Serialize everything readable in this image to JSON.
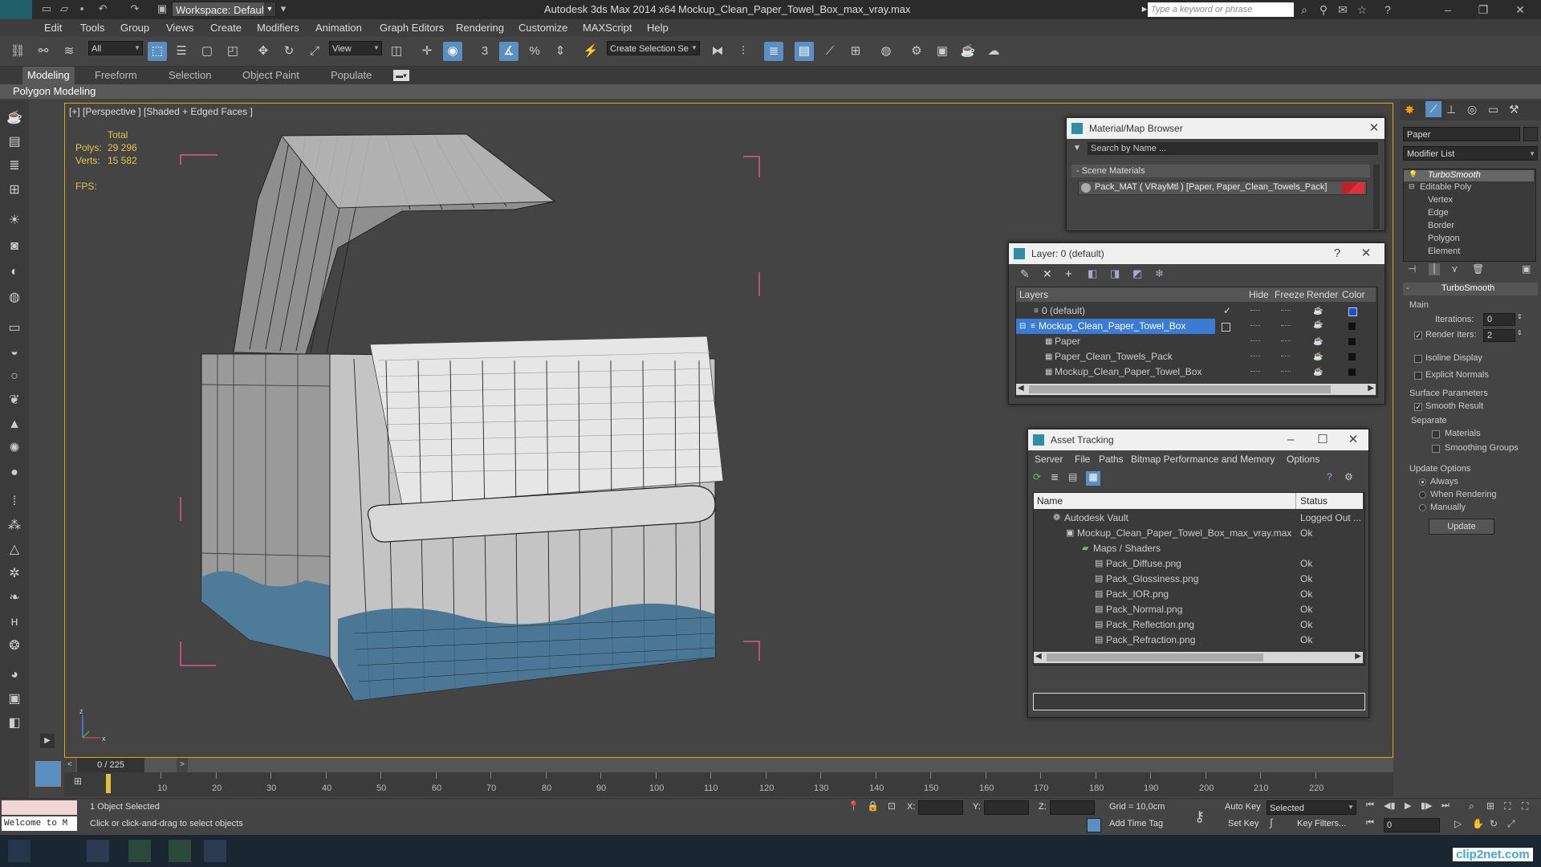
{
  "titlebar": {
    "workspace": "Workspace: Default",
    "app_title": "Autodesk 3ds Max  2014 x64",
    "file_title": "Mockup_Clean_Paper_Towel_Box_max_vray.max",
    "search_placeholder": "Type a keyword or phrase"
  },
  "menu": [
    "Edit",
    "Tools",
    "Group",
    "Views",
    "Create",
    "Modifiers",
    "Animation",
    "Graph Editors",
    "Rendering",
    "Customize",
    "MAXScript",
    "Help"
  ],
  "toolbar": {
    "filter_value": "All",
    "view_value": "View",
    "selection_set": "Create Selection Se"
  },
  "ribbon": {
    "tabs": [
      "Modeling",
      "Freeform",
      "Selection",
      "Object Paint",
      "Populate"
    ],
    "sub_label": "Polygon Modeling"
  },
  "viewport": {
    "label": "[+] [Perspective ] [Shaded + Edged Faces ]",
    "total_label": "Total",
    "polys_label": "Polys:",
    "polys_value": "29 296",
    "verts_label": "Verts:",
    "verts_value": "15 582",
    "fps_label": "FPS:"
  },
  "material_browser": {
    "title": "Material/Map Browser",
    "search_placeholder": "Search by Name ...",
    "section": "- Scene Materials",
    "item": "Pack_MAT  ( VRayMtl )  [Paper, Paper_Clean_Towels_Pack]"
  },
  "layer_dialog": {
    "title": "Layer: 0 (default)",
    "help": "?",
    "headers": {
      "layers": "Layers",
      "hide": "Hide",
      "freeze": "Freeze",
      "render": "Render",
      "color": "Color"
    },
    "rows": [
      {
        "name": "0 (default)",
        "indent": 0
      },
      {
        "name": "Mockup_Clean_Paper_Towel_Box",
        "indent": 0
      },
      {
        "name": "Paper",
        "indent": 1
      },
      {
        "name": "Paper_Clean_Towels_Pack",
        "indent": 1
      },
      {
        "name": "Mockup_Clean_Paper_Towel_Box",
        "indent": 1
      }
    ]
  },
  "asset_tracking": {
    "title": "Asset Tracking",
    "menu": [
      "Server",
      "File",
      "Paths",
      "Bitmap Performance and Memory",
      "Options"
    ],
    "headers": {
      "name": "Name",
      "status": "Status"
    },
    "rows": [
      {
        "name": "Autodesk Vault",
        "status": "Logged Out ...",
        "indent": 0
      },
      {
        "name": "Mockup_Clean_Paper_Towel_Box_max_vray.max",
        "status": "Ok",
        "indent": 1
      },
      {
        "name": "Maps / Shaders",
        "status": "",
        "indent": 2
      },
      {
        "name": "Pack_Diffuse.png",
        "status": "Ok",
        "indent": 3
      },
      {
        "name": "Pack_Glossiness.png",
        "status": "Ok",
        "indent": 3
      },
      {
        "name": "Pack_IOR.png",
        "status": "Ok",
        "indent": 3
      },
      {
        "name": "Pack_Normal.png",
        "status": "Ok",
        "indent": 3
      },
      {
        "name": "Pack_Reflection.png",
        "status": "Ok",
        "indent": 3
      },
      {
        "name": "Pack_Refraction.png",
        "status": "Ok",
        "indent": 3
      }
    ]
  },
  "command_panel": {
    "object_name": "Paper",
    "modifier_list": "Modifier List",
    "stack": [
      {
        "name": "TurboSmooth",
        "indent": 0,
        "italic": true
      },
      {
        "name": "Editable Poly",
        "indent": 0,
        "italic": false
      },
      {
        "name": "Vertex",
        "indent": 1,
        "italic": false
      },
      {
        "name": "Edge",
        "indent": 1,
        "italic": false
      },
      {
        "name": "Border",
        "indent": 1,
        "italic": false
      },
      {
        "name": "Polygon",
        "indent": 1,
        "italic": false
      },
      {
        "name": "Element",
        "indent": 1,
        "italic": false
      }
    ],
    "rollout_title": "TurboSmooth",
    "main_label": "Main",
    "iterations_label": "Iterations:",
    "iterations_value": "0",
    "render_iters_label": "Render Iters:",
    "render_iters_value": "2",
    "isoline": "Isoline Display",
    "explicit_normals": "Explicit Normals",
    "surface_params": "Surface Parameters",
    "smooth_result": "Smooth Result",
    "separate": "Separate",
    "materials": "Materials",
    "smoothing_groups": "Smoothing Groups",
    "update_options": "Update Options",
    "always": "Always",
    "when_rendering": "When Rendering",
    "manually": "Manually",
    "update_btn": "Update"
  },
  "timeline": {
    "frame_counter": "0 / 225",
    "ticks": [
      "10",
      "20",
      "30",
      "40",
      "50",
      "60",
      "70",
      "80",
      "90",
      "100",
      "110",
      "120",
      "130",
      "140",
      "150",
      "160",
      "170",
      "180",
      "190",
      "200",
      "210",
      "220"
    ]
  },
  "status": {
    "maxscript": "Welcome to M",
    "selected": "1 Object Selected",
    "prompt": "Click or click-and-drag to select objects",
    "x_label": "X:",
    "y_label": "Y:",
    "z_label": "Z:",
    "grid": "Grid = 10,0cm",
    "add_time_tag": "Add Time Tag",
    "auto_key": "Auto Key",
    "set_key": "Set Key",
    "selected_dropdown": "Selected",
    "key_filters": "Key Filters...",
    "frame_field": "0"
  },
  "watermark": "clip2net.com",
  "colors": {
    "accent": "#5b8fc2",
    "viewport_border": "#e0a800",
    "selection": "#3a7bd5"
  }
}
